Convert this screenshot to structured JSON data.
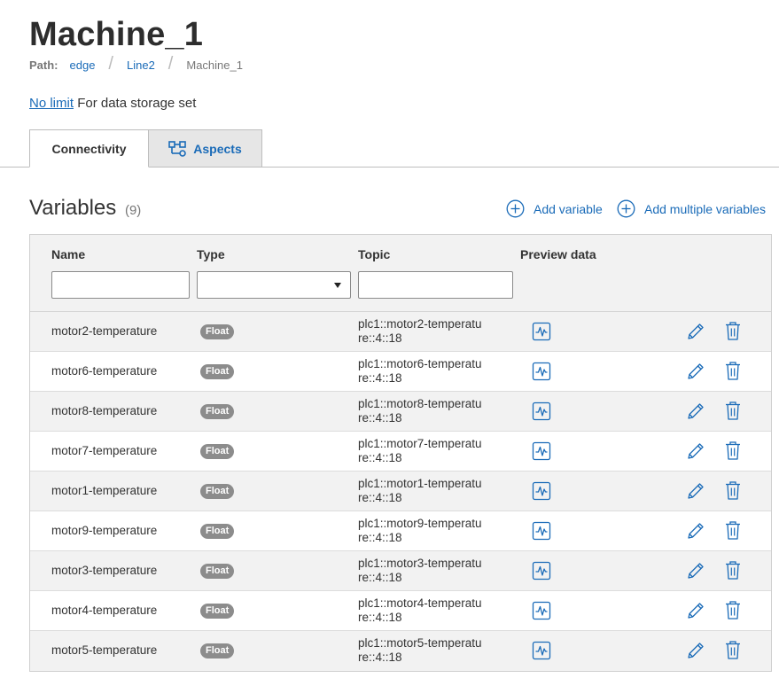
{
  "page": {
    "title": "Machine_1",
    "path_label": "Path:",
    "breadcrumb": [
      "edge",
      "Line2",
      "Machine_1"
    ],
    "storage_link": "No limit",
    "storage_text": "For data storage set"
  },
  "tabs": {
    "connectivity": "Connectivity",
    "aspects": "Aspects"
  },
  "variables": {
    "title": "Variables",
    "count": "(9)",
    "add_variable": "Add variable",
    "add_multiple": "Add multiple variables",
    "columns": {
      "name": "Name",
      "type": "Type",
      "topic": "Topic",
      "preview": "Preview data"
    },
    "filters": {
      "name": "",
      "type": "",
      "topic": ""
    },
    "rows": [
      {
        "name": "motor2-temperature",
        "type": "Float",
        "topic": "plc1::motor2-temperature::4::18"
      },
      {
        "name": "motor6-temperature",
        "type": "Float",
        "topic": "plc1::motor6-temperature::4::18"
      },
      {
        "name": "motor8-temperature",
        "type": "Float",
        "topic": "plc1::motor8-temperature::4::18"
      },
      {
        "name": "motor7-temperature",
        "type": "Float",
        "topic": "plc1::motor7-temperature::4::18"
      },
      {
        "name": "motor1-temperature",
        "type": "Float",
        "topic": "plc1::motor1-temperature::4::18"
      },
      {
        "name": "motor9-temperature",
        "type": "Float",
        "topic": "plc1::motor9-temperature::4::18"
      },
      {
        "name": "motor3-temperature",
        "type": "Float",
        "topic": "plc1::motor3-temperature::4::18"
      },
      {
        "name": "motor4-temperature",
        "type": "Float",
        "topic": "plc1::motor4-temperature::4::18"
      },
      {
        "name": "motor5-temperature",
        "type": "Float",
        "topic": "plc1::motor5-temperature::4::18"
      }
    ]
  },
  "colors": {
    "accent": "#1a6bb8",
    "badge": "#8c8c8c",
    "header_bg": "#f2f2f2"
  },
  "icons": {
    "preview": "chart-preview-icon",
    "edit": "pencil-icon",
    "delete": "trash-icon",
    "add": "plus-circle-icon",
    "aspects": "hierarchy-icon"
  }
}
